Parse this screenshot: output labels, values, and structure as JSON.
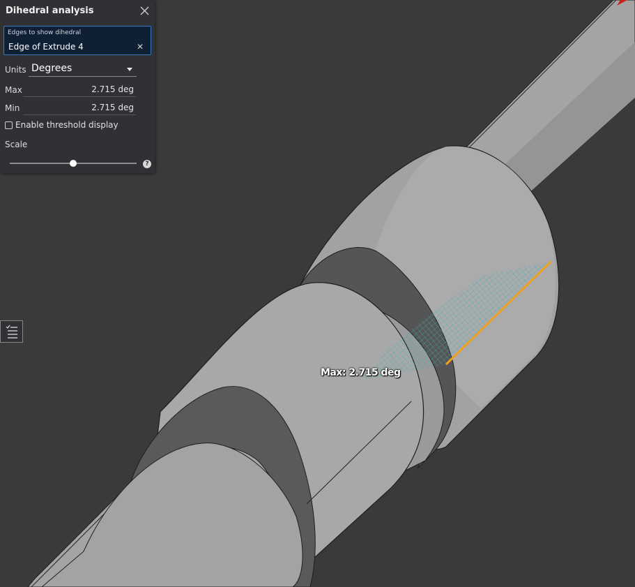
{
  "panel": {
    "title": "Dihedral analysis",
    "selection": {
      "label": "Edges to show dihedral",
      "value": "Edge of Extrude 4"
    },
    "units": {
      "label": "Units",
      "value": "Degrees"
    },
    "max": {
      "label": "Max",
      "value": "2.715 deg"
    },
    "min": {
      "label": "Min",
      "value": "2.715 deg"
    },
    "threshold": {
      "label": "Enable threshold display",
      "checked": false
    },
    "scale": {
      "label": "Scale",
      "level": 0.5
    }
  },
  "viewport": {
    "measurement_label": "Max: 2.715 deg"
  },
  "colors": {
    "background": "#3a3a3a",
    "panel": "#2f3134",
    "selection_border": "#3a78c2",
    "edge_highlight": "#f0a020",
    "dihedral_mesh": "#3ab0b8"
  },
  "icons": [
    "close-icon",
    "clear-icon",
    "chevron-down-icon",
    "help-icon",
    "list-icon"
  ]
}
